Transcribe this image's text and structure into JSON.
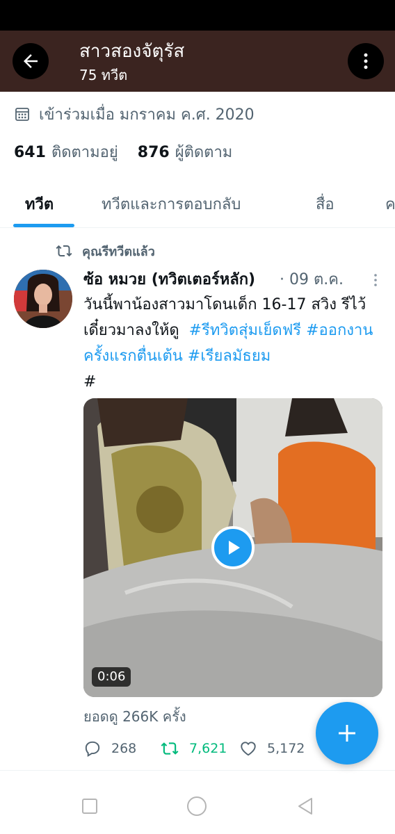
{
  "header": {
    "title": "สาวสองจัตุรัส",
    "subtitle": "75 ทวีต"
  },
  "profile": {
    "joined": "เข้าร่วมเมื่อ มกราคม ค.ศ. 2020",
    "following_count": "641",
    "following_label": "ติดตามอยู่",
    "followers_count": "876",
    "followers_label": "ผู้ติดตาม"
  },
  "tabs": [
    {
      "label": "ทวีต",
      "active": true
    },
    {
      "label": "ทวีตและการตอบกลับ",
      "active": false
    },
    {
      "label": "สื่อ",
      "active": false
    },
    {
      "label": "ค",
      "active": false
    }
  ],
  "tweet": {
    "retweet_label": "คุณรีทวีตแล้ว",
    "author": "ซ้อ หมวย (ทวิตเตอร์หลัก)",
    "date": "· 09 ต.ค.",
    "text_plain": "วันนี้พาน้องสาวมาโดนเด็ก 16-17 สวิง รีไว้เดี๋ยวมาลงให้ดู",
    "hashtag_1": "#รีทวิตสุ่มเย็ดฟรี",
    "hashtag_2": "#ออกงานครั้งแรกตื่นเต้น",
    "hashtag_3": "#เรียลมัธยม",
    "trailing": "#",
    "video_duration": "0:06",
    "views": "ยอดดู 266K ครั้ง",
    "replies": "268",
    "retweets": "7,621",
    "likes": "5,172"
  },
  "colors": {
    "header_bg": "#3b2420",
    "accent": "#1d9bf0",
    "retweet_green": "#00ba7c",
    "secondary_text": "#536471"
  },
  "icons": {
    "back": "arrow-left-icon",
    "more": "more-vertical-icon",
    "calendar": "calendar-icon",
    "retweet": "retweet-icon",
    "reply": "reply-icon",
    "like": "heart-icon",
    "compose": "plus-icon",
    "play": "play-icon"
  }
}
